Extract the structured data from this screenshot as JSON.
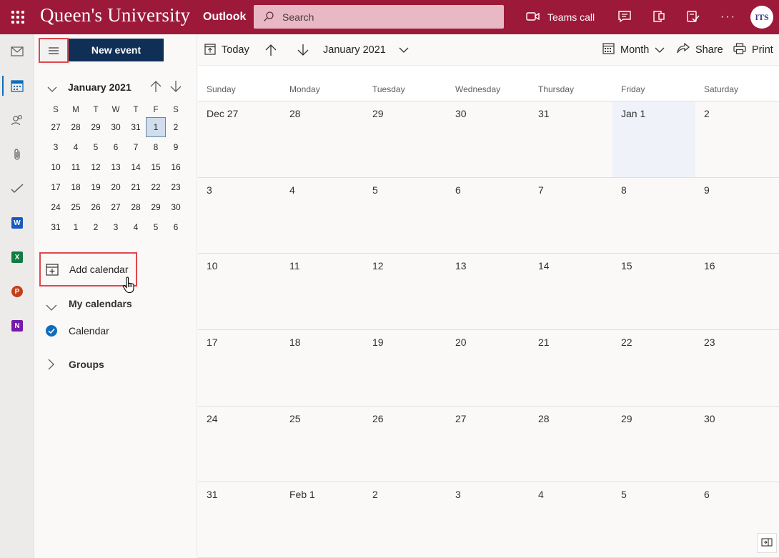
{
  "header": {
    "brand": "Queen's University",
    "app_name": "Outlook",
    "search_placeholder": "Search",
    "teams_call_label": "Teams call",
    "avatar_initials": "ITS",
    "accent_color": "#9d1939"
  },
  "rail": {
    "icons": [
      "mail-icon",
      "calendar-icon",
      "people-icon",
      "files-icon",
      "todo-icon",
      "word-icon",
      "excel-icon",
      "powerpoint-icon",
      "onenote-icon"
    ],
    "active": "calendar-icon"
  },
  "navpane": {
    "new_event_label": "New event",
    "mini_calendar": {
      "title": "January 2021",
      "weekdays": [
        "S",
        "M",
        "T",
        "W",
        "T",
        "F",
        "S"
      ],
      "weeks": [
        [
          "27",
          "28",
          "29",
          "30",
          "31",
          "1",
          "2"
        ],
        [
          "3",
          "4",
          "5",
          "6",
          "7",
          "8",
          "9"
        ],
        [
          "10",
          "11",
          "12",
          "13",
          "14",
          "15",
          "16"
        ],
        [
          "17",
          "18",
          "19",
          "20",
          "21",
          "22",
          "23"
        ],
        [
          "24",
          "25",
          "26",
          "27",
          "28",
          "29",
          "30"
        ],
        [
          "31",
          "1",
          "2",
          "3",
          "4",
          "5",
          "6"
        ]
      ],
      "selected_day": "1"
    },
    "add_calendar_label": "Add calendar",
    "my_calendars_label": "My calendars",
    "calendar_item_label": "Calendar",
    "groups_label": "Groups"
  },
  "toolbar": {
    "today_label": "Today",
    "period_label": "January 2021",
    "view_label": "Month",
    "share_label": "Share",
    "print_label": "Print"
  },
  "month_view": {
    "weekdays": [
      "Sunday",
      "Monday",
      "Tuesday",
      "Wednesday",
      "Thursday",
      "Friday",
      "Saturday"
    ],
    "weeks": [
      [
        "Dec 27",
        "28",
        "29",
        "30",
        "31",
        "Jan 1",
        "2"
      ],
      [
        "3",
        "4",
        "5",
        "6",
        "7",
        "8",
        "9"
      ],
      [
        "10",
        "11",
        "12",
        "13",
        "14",
        "15",
        "16"
      ],
      [
        "17",
        "18",
        "19",
        "20",
        "21",
        "22",
        "23"
      ],
      [
        "24",
        "25",
        "26",
        "27",
        "28",
        "29",
        "30"
      ],
      [
        "31",
        "Feb 1",
        "2",
        "3",
        "4",
        "5",
        "6"
      ]
    ],
    "today_label": "Jan 1"
  }
}
